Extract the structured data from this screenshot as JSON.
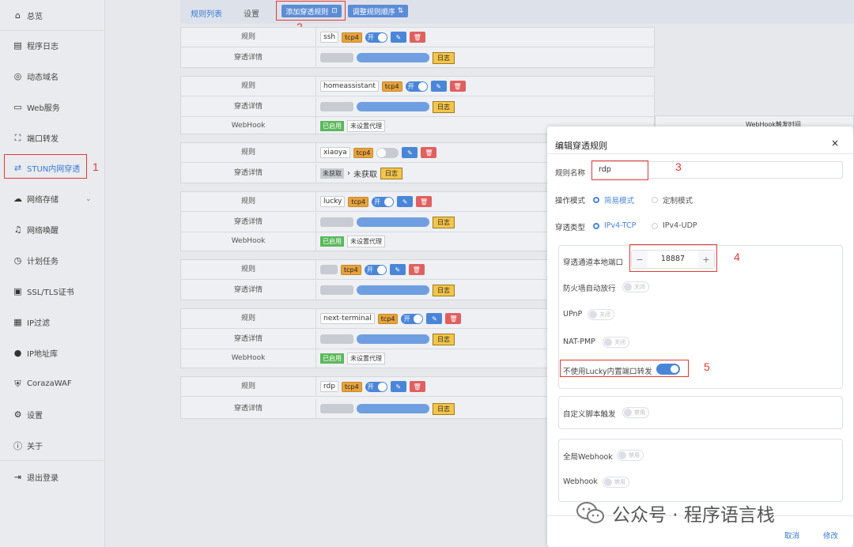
{
  "sidebar": {
    "items": [
      {
        "label": "总览",
        "icon": "home-icon"
      },
      {
        "label": "程序日志",
        "icon": "log-icon"
      },
      {
        "label": "动态域名",
        "icon": "globe-icon"
      },
      {
        "label": "Web服务",
        "icon": "web-icon"
      },
      {
        "label": "端口转发",
        "icon": "port-icon"
      },
      {
        "label": "STUN内网穿透",
        "icon": "stun-icon"
      },
      {
        "label": "网络存储",
        "icon": "cloud-icon"
      },
      {
        "label": "网络唤醒",
        "icon": "bell-icon"
      },
      {
        "label": "计划任务",
        "icon": "clock-icon"
      },
      {
        "label": "SSL/TLS证书",
        "icon": "cert-icon"
      },
      {
        "label": "IP过滤",
        "icon": "filter-icon"
      },
      {
        "label": "IP地址库",
        "icon": "user-icon"
      },
      {
        "label": "CorazaWAF",
        "icon": "shield-icon"
      },
      {
        "label": "设置",
        "icon": "gear-icon"
      },
      {
        "label": "关于",
        "icon": "info-icon"
      },
      {
        "label": "退出登录",
        "icon": "logout-icon"
      }
    ],
    "active_index": 5
  },
  "topbar": {
    "tab_rules": "规则列表",
    "tab_settings": "设置",
    "add_rule": "添加穿透规则",
    "reorder": "调整规则顺序"
  },
  "rules": [
    {
      "name": "ssh",
      "proto": "tcp4",
      "enabled": true,
      "webhook": false
    },
    {
      "name": "homeassistant",
      "proto": "tcp4",
      "enabled": true,
      "webhook": true
    },
    {
      "name": "xiaoya",
      "proto": "tcp4",
      "enabled": false,
      "webhook": false,
      "detail_a": "未获取",
      "detail_b": "未获取"
    },
    {
      "name": "lucky",
      "proto": "tcp4",
      "enabled": true,
      "webhook": true
    },
    {
      "name": "",
      "proto": "tcp4",
      "enabled": true,
      "webhook": false
    },
    {
      "name": "next-terminal",
      "proto": "tcp4",
      "enabled": true,
      "webhook": true
    },
    {
      "name": "rdp",
      "proto": "tcp4",
      "enabled": true,
      "webhook": false
    }
  ],
  "labels": {
    "rule": "规则",
    "detail": "穿透详情",
    "webhook": "WebHook",
    "on": "开",
    "log": "日志",
    "enabled": "已启用",
    "no_proxy": "未设置代理",
    "webhook_partial": "WebHook触发时间"
  },
  "dialog": {
    "title": "编辑穿透规则",
    "close": "×",
    "name_label": "规则名称",
    "name_value": "rdp",
    "mode_label": "操作模式",
    "mode_simple": "简易模式",
    "mode_custom": "定制模式",
    "type_label": "穿透类型",
    "type_tcp": "IPv4-TCP",
    "type_udp": "IPv4-UDP",
    "port_label": "穿透通道本地端口",
    "port_value": "18887",
    "minus": "−",
    "plus": "+",
    "firewall_label": "防火墙自动放行",
    "upnp_label": "UPnP",
    "natpmp_label": "NAT-PMP",
    "nolucky_label": "不使用Lucky内置端口转发",
    "script_label": "自定义脚本触发",
    "global_webhook_label": "全局Webhook",
    "webhook_label": "Webhook",
    "toggle_off_text": "关闭",
    "toggle_disabled_text": "禁用",
    "cancel": "取消",
    "save": "修改"
  },
  "annotations": [
    "1",
    "2",
    "3",
    "4",
    "5"
  ],
  "watermark": "公众号 · 程序语言栈",
  "colors": {
    "accent": "#4a86d8",
    "highlight": "#e53935",
    "delete": "#e06060",
    "log": "#f3c54a",
    "enabled_green": "#5bb85b"
  }
}
